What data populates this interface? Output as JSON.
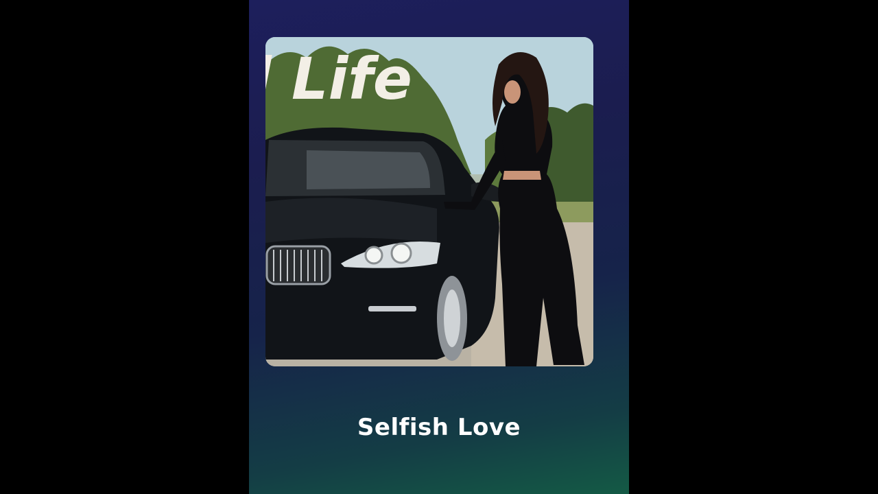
{
  "player": {
    "song_title": "Selfish Love"
  },
  "album_art": {
    "cover_text": "l Life"
  },
  "colors": {
    "panel_top": "#1d1f5c",
    "panel_bottom": "#145a45",
    "outer_background": "#000000",
    "title_color": "#ffffff"
  }
}
